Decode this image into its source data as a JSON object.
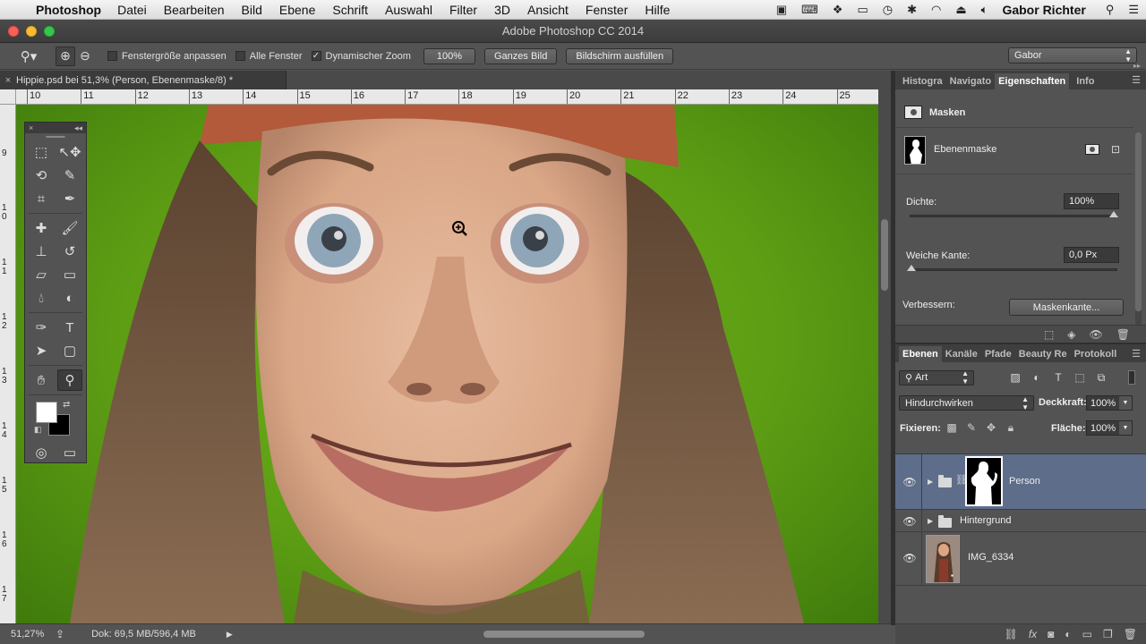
{
  "menubar": {
    "app_name": "Photoshop",
    "items": [
      "Datei",
      "Bearbeiten",
      "Bild",
      "Ebene",
      "Schrift",
      "Auswahl",
      "Filter",
      "3D",
      "Ansicht",
      "Fenster",
      "Hilfe"
    ],
    "user": "Gabor Richter"
  },
  "window": {
    "title": "Adobe Photoshop CC 2014"
  },
  "options": {
    "fit_window_label": "Fenstergröße anpassen",
    "all_windows_label": "Alle Fenster",
    "dynamic_zoom_label": "Dynamischer Zoom",
    "btn_100": "100%",
    "btn_fit_image": "Ganzes Bild",
    "btn_fill_screen": "Bildschirm ausfüllen",
    "workspace": "Gabor",
    "fit_window_checked": false,
    "all_windows_checked": false,
    "dynamic_zoom_checked": true
  },
  "document": {
    "tab_title": "Hippie.psd bei 51,3% (Person, Ebenenmaske/8) *",
    "ruler_h": [
      "10",
      "11",
      "12",
      "13",
      "14",
      "15",
      "16",
      "17",
      "18",
      "19",
      "20",
      "21",
      "22",
      "23",
      "24",
      "25"
    ],
    "ruler_v": [
      "9",
      "1\n0",
      "1\n1",
      "1\n2",
      "1\n3",
      "1\n4",
      "1\n5",
      "1\n6",
      "1\n7"
    ]
  },
  "status": {
    "zoom": "51,27%",
    "doc_size": "Dok: 69,5 MB/596,4 MB"
  },
  "properties_panel": {
    "tabs": [
      "Histogra",
      "Navigato",
      "Eigenschaften",
      "Info"
    ],
    "active_tab": "Eigenschaften",
    "section_title": "Masken",
    "mask_label": "Ebenenmaske",
    "density_label": "Dichte:",
    "density_value": "100%",
    "density_level": 1.0,
    "feather_label": "Weiche Kante:",
    "feather_value": "0,0 Px",
    "feather_level": 0.0,
    "refine_label": "Verbessern:",
    "refine_button": "Maskenkante..."
  },
  "layers_panel": {
    "tabs": [
      "Ebenen",
      "Kanäle",
      "Pfade",
      "Beauty Re",
      "Protokoll"
    ],
    "active_tab": "Ebenen",
    "filter_kind": "Art",
    "blend_mode": "Hindurchwirken",
    "opacity_label": "Deckkraft:",
    "opacity_value": "100%",
    "lock_label": "Fixieren:",
    "fill_label": "Fläche:",
    "fill_value": "100%",
    "layers": [
      {
        "name": "Person",
        "type": "group-with-mask",
        "visible": true,
        "selected": true
      },
      {
        "name": "Hintergrund",
        "type": "group",
        "visible": true,
        "selected": false
      },
      {
        "name": "IMG_6334",
        "type": "image",
        "visible": true,
        "selected": false
      }
    ]
  },
  "colors": {
    "canvas_bg": "#5d9d14",
    "selected_layer": "#5e6d8a",
    "panel_bg": "#535353"
  }
}
